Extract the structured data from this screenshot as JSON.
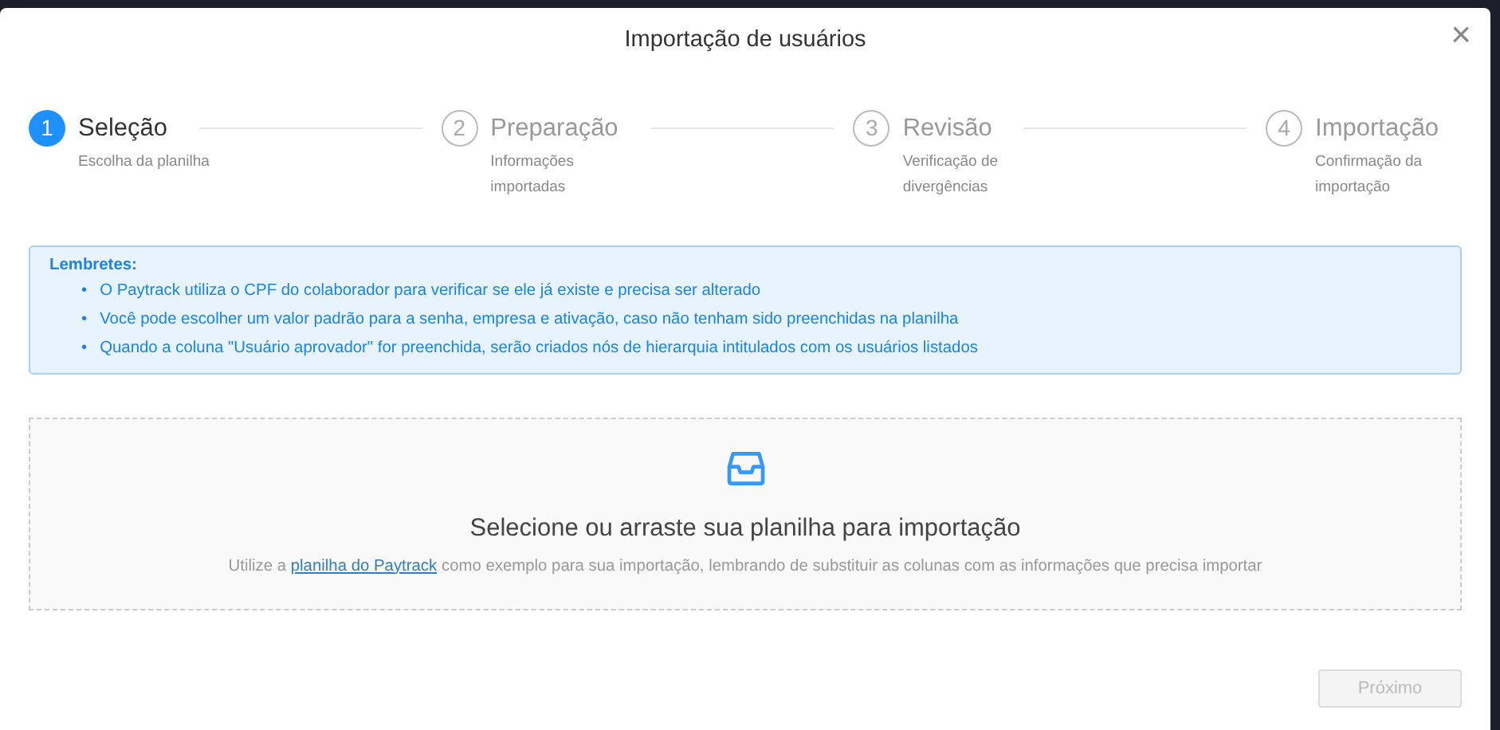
{
  "modal": {
    "title": "Importação de usuários",
    "close": "×"
  },
  "steps": [
    {
      "number": "1",
      "title": "Seleção",
      "subtitle": "Escolha da planilha",
      "active": true
    },
    {
      "number": "2",
      "title": "Preparação",
      "subtitle": "Informações importadas",
      "active": false
    },
    {
      "number": "3",
      "title": "Revisão",
      "subtitle": "Verificação de divergências",
      "active": false
    },
    {
      "number": "4",
      "title": "Importação",
      "subtitle": "Confirmação da importação",
      "active": false
    }
  ],
  "reminders": {
    "title": "Lembretes:",
    "items": [
      {
        "bullet": "•",
        "text": "O Paytrack utiliza o CPF do colaborador para verificar se ele já existe e precisa ser alterado"
      },
      {
        "bullet": "•",
        "text": "Você pode escolher um valor padrão para a senha, empresa e ativação, caso não tenham sido preenchidas na planilha"
      },
      {
        "bullet": "•",
        "text": "Quando a coluna \"Usuário aprovador\" for preenchida, serão criados nós de hierarquia intitulados com os usuários listados"
      }
    ]
  },
  "dropzone": {
    "heading": "Selecione ou arraste sua planilha para importação",
    "hint_before": "Utilize a",
    "link": "planilha do Paytrack",
    "hint_after": "como exemplo para sua importação, lembrando de substituir as colunas com as informações que precisa importar"
  },
  "next_button": {
    "label": "Próximo",
    "disabled": true
  }
}
